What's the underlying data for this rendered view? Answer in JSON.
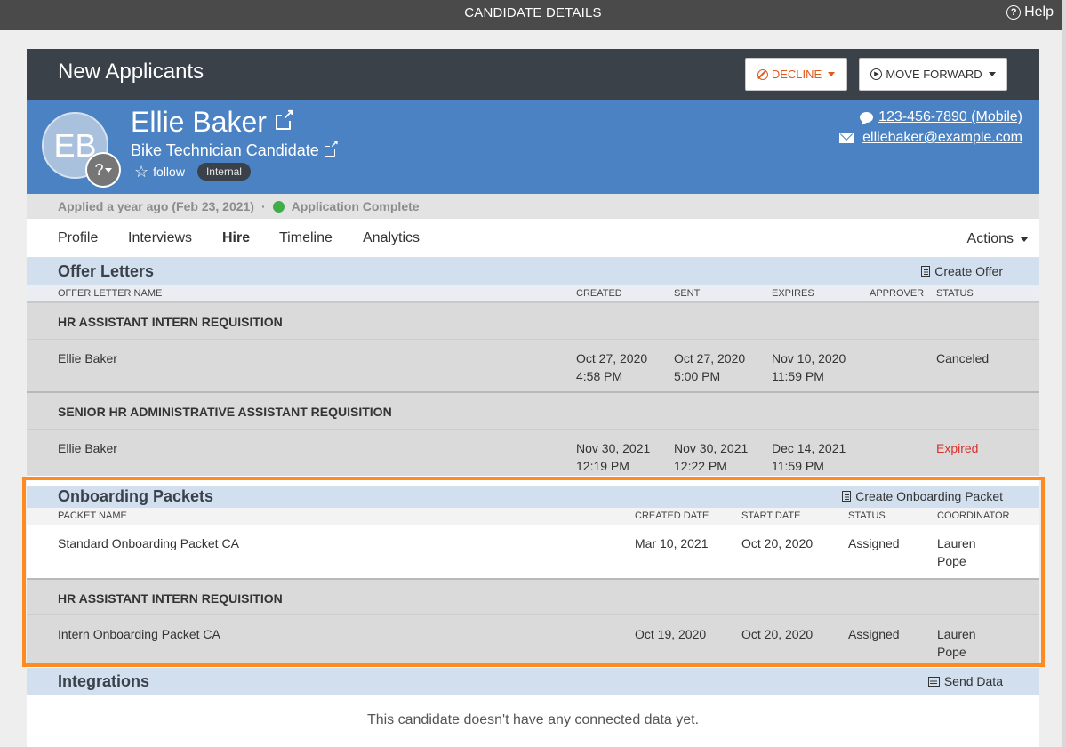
{
  "topbar": {
    "title": "CANDIDATE DETAILS",
    "help_label": "Help"
  },
  "header": {
    "stage": "New Applicants",
    "decline_label": "DECLINE",
    "move_forward_label": "MOVE FORWARD"
  },
  "candidate": {
    "initials": "EB",
    "avatar_placeholder": "?",
    "name": "Ellie Baker",
    "role": "Bike Technician Candidate",
    "follow_label": "follow",
    "badge": "Internal",
    "phone": "123-456-7890 (Mobile)",
    "email": "elliebaker@example.com"
  },
  "status": {
    "applied": "Applied a year ago (Feb 23, 2021)",
    "separator": "·",
    "application": "Application Complete"
  },
  "tabs": {
    "items": [
      "Profile",
      "Interviews",
      "Hire",
      "Timeline",
      "Analytics"
    ],
    "active": "Hire",
    "actions_label": "Actions"
  },
  "offer_letters": {
    "title": "Offer Letters",
    "action": "Create Offer",
    "columns": [
      "OFFER LETTER NAME",
      "CREATED",
      "SENT",
      "EXPIRES",
      "APPROVER",
      "STATUS"
    ],
    "groups": [
      {
        "requisition": "HR ASSISTANT INTERN REQUISITION",
        "name": "Ellie Baker",
        "created": [
          "Oct 27, 2020",
          "4:58 PM"
        ],
        "sent": [
          "Oct 27, 2020",
          "5:00 PM"
        ],
        "expires": [
          "Nov 10, 2020",
          "11:59 PM"
        ],
        "approver": "",
        "status": "Canceled"
      },
      {
        "requisition": "SENIOR HR ADMINISTRATIVE ASSISTANT REQUISITION",
        "name": "Ellie Baker",
        "created": [
          "Nov 30, 2021",
          "12:19 PM"
        ],
        "sent": [
          "Nov 30, 2021",
          "12:22 PM"
        ],
        "expires": [
          "Dec 14, 2021",
          "11:59 PM"
        ],
        "approver": "",
        "status": "Expired"
      }
    ]
  },
  "onboarding": {
    "title": "Onboarding Packets",
    "action": "Create Onboarding Packet",
    "columns": [
      "PACKET NAME",
      "CREATED DATE",
      "START DATE",
      "STATUS",
      "COORDINATOR"
    ],
    "rows": [
      {
        "name": "Standard Onboarding Packet CA",
        "created": "Mar 10, 2021",
        "start": "Oct 20, 2020",
        "status": "Assigned",
        "coordinator": [
          "Lauren",
          "Pope"
        ]
      },
      {
        "requisition": "HR ASSISTANT INTERN REQUISITION",
        "name": "Intern Onboarding Packet CA",
        "created": "Oct 19, 2020",
        "start": "Oct 20, 2020",
        "status": "Assigned",
        "coordinator": [
          "Lauren",
          "Pope"
        ]
      }
    ]
  },
  "integrations": {
    "title": "Integrations",
    "action": "Send Data",
    "empty": "This candidate doesn't have any connected data yet."
  },
  "colors": {
    "topbar": "#4a4a4a",
    "dark_header": "#3a4149",
    "blue_header": "#4a82c3",
    "section_head": "#d2dfee",
    "decline": "#e05a1b",
    "expired": "#d9322d",
    "complete_dot": "#3fae49",
    "highlight": "#ff8a1f"
  }
}
